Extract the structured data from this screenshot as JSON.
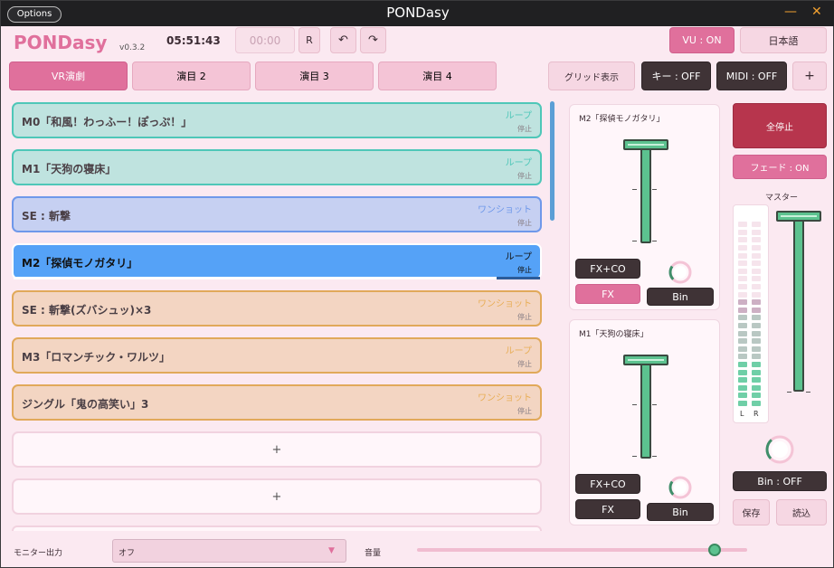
{
  "window": {
    "title": "PONDasy",
    "options_label": "Options",
    "minimize": "—",
    "close": "✕"
  },
  "header": {
    "app_name": "PONDasy",
    "version": "v0.3.2",
    "clock": "05:51:43",
    "timer": "00:00",
    "r_label": "R",
    "undo_icon": "↶",
    "redo_icon": "↷",
    "vu_label": "VU : ON",
    "lang_label": "日本語"
  },
  "tabs": [
    {
      "label": "VR演劇",
      "active": true
    },
    {
      "label": "演目 2"
    },
    {
      "label": "演目 3"
    },
    {
      "label": "演目 4"
    }
  ],
  "toolbar": {
    "grid": "グリッド表示",
    "key": "キー : OFF",
    "midi": "MIDI : OFF",
    "add": "+"
  },
  "cues": [
    {
      "name": "M0「和風！わっふー！ぽっぷ！」",
      "mode": "ループ",
      "state": "停止",
      "style": "teal"
    },
    {
      "name": "M1「天狗の寝床」",
      "mode": "ループ",
      "state": "停止",
      "style": "teal"
    },
    {
      "name": "SE : 斬撃",
      "mode": "ワンショット",
      "state": "停止",
      "style": "lavender"
    },
    {
      "name": "M2「探偵モノガタリ」",
      "mode": "ループ",
      "state": "停止",
      "style": "active"
    },
    {
      "name": "SE : 斬撃(ズバシュッ)×3",
      "mode": "ワンショット",
      "state": "停止",
      "style": "peach"
    },
    {
      "name": "M3「ロマンチック・ワルツ」",
      "mode": "ループ",
      "state": "停止",
      "style": "peach"
    },
    {
      "name": "ジングル「鬼の高笑い」3",
      "mode": "ワンショット",
      "state": "停止",
      "style": "peach"
    }
  ],
  "empty_slots": [
    "+",
    "+"
  ],
  "decks": [
    {
      "title": "M2「探偵モノガタリ」",
      "fxco": "FX+CO",
      "fx": "FX",
      "bin": "Bin",
      "fx_active": true,
      "knob_level": 0.3
    },
    {
      "title": "M1「天狗の寝床」",
      "fxco": "FX+CO",
      "fx": "FX",
      "bin": "Bin",
      "fx_active": false,
      "knob_level": 0.3
    }
  ],
  "master": {
    "stop_all": "全停止",
    "fade": "フェード : ON",
    "label": "マスター",
    "meter_l": "L",
    "meter_r": "R",
    "bin": "Bin : OFF",
    "save": "保存",
    "load": "読込",
    "knob_level": 0.35,
    "meter_level_l": 0.55,
    "meter_level_r": 0.55
  },
  "footer": {
    "monitor_label": "モニター出力",
    "monitor_value": "オフ",
    "volume_label": "音量",
    "volume_value": 0.9
  },
  "colors": {
    "accent": "#e0709c",
    "stop": "#b7354d",
    "fader": "#5cc28f",
    "active_cue": "#55a2f7"
  }
}
